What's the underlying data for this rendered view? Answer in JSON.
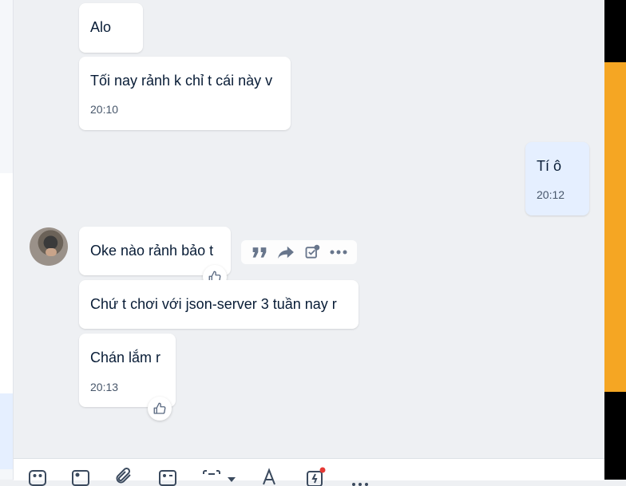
{
  "colors": {
    "bubble_incoming": "#ffffff",
    "bubble_outgoing": "#e5efff",
    "chat_background": "#eef0f3",
    "text_primary": "#081c36",
    "text_time": "#47566a",
    "icon": "#5a6981",
    "accent_strip": "#f5a623"
  },
  "messages": [
    {
      "text": "Alo",
      "time": ""
    },
    {
      "text": "Tối nay rảnh k chỉ t cái này v",
      "time": "20:10"
    },
    {
      "text": "Tí ô",
      "time": "20:12"
    },
    {
      "text": "Oke nào rảnh bảo t",
      "time": ""
    },
    {
      "text": "Chứ t chơi với json-server 3 tuần nay r",
      "time": ""
    },
    {
      "text": "Chán lắm r",
      "time": "20:13"
    }
  ],
  "message_actions": [
    "quote-icon",
    "forward-icon",
    "add-task-icon",
    "more-icon"
  ],
  "reactions": [
    "thumbs-up-icon",
    "thumbs-up-icon"
  ],
  "composer_tools": [
    "sticker-icon",
    "image-icon",
    "attachment-icon",
    "contact-card-icon",
    "screenshot-icon",
    "dropdown-caret-icon",
    "text-format-icon",
    "quick-message-icon",
    "more-options-icon"
  ]
}
